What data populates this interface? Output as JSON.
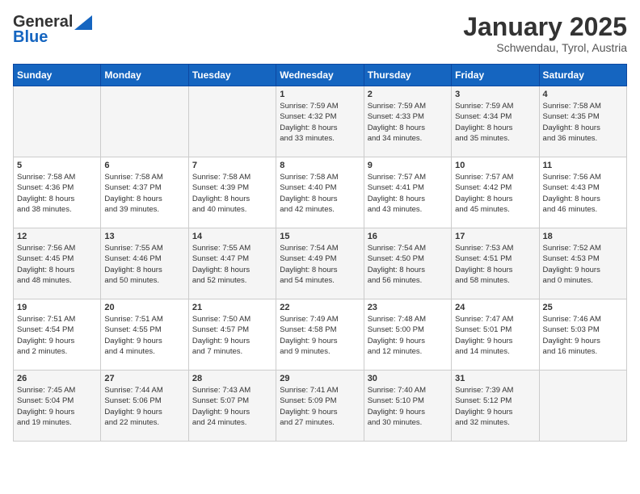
{
  "header": {
    "logo_line1": "General",
    "logo_line2": "Blue",
    "title": "January 2025",
    "subtitle": "Schwendau, Tyrol, Austria"
  },
  "calendar": {
    "days_of_week": [
      "Sunday",
      "Monday",
      "Tuesday",
      "Wednesday",
      "Thursday",
      "Friday",
      "Saturday"
    ],
    "weeks": [
      [
        {
          "day": "",
          "info": ""
        },
        {
          "day": "",
          "info": ""
        },
        {
          "day": "",
          "info": ""
        },
        {
          "day": "1",
          "info": "Sunrise: 7:59 AM\nSunset: 4:32 PM\nDaylight: 8 hours\nand 33 minutes."
        },
        {
          "day": "2",
          "info": "Sunrise: 7:59 AM\nSunset: 4:33 PM\nDaylight: 8 hours\nand 34 minutes."
        },
        {
          "day": "3",
          "info": "Sunrise: 7:59 AM\nSunset: 4:34 PM\nDaylight: 8 hours\nand 35 minutes."
        },
        {
          "day": "4",
          "info": "Sunrise: 7:58 AM\nSunset: 4:35 PM\nDaylight: 8 hours\nand 36 minutes."
        }
      ],
      [
        {
          "day": "5",
          "info": "Sunrise: 7:58 AM\nSunset: 4:36 PM\nDaylight: 8 hours\nand 38 minutes."
        },
        {
          "day": "6",
          "info": "Sunrise: 7:58 AM\nSunset: 4:37 PM\nDaylight: 8 hours\nand 39 minutes."
        },
        {
          "day": "7",
          "info": "Sunrise: 7:58 AM\nSunset: 4:39 PM\nDaylight: 8 hours\nand 40 minutes."
        },
        {
          "day": "8",
          "info": "Sunrise: 7:58 AM\nSunset: 4:40 PM\nDaylight: 8 hours\nand 42 minutes."
        },
        {
          "day": "9",
          "info": "Sunrise: 7:57 AM\nSunset: 4:41 PM\nDaylight: 8 hours\nand 43 minutes."
        },
        {
          "day": "10",
          "info": "Sunrise: 7:57 AM\nSunset: 4:42 PM\nDaylight: 8 hours\nand 45 minutes."
        },
        {
          "day": "11",
          "info": "Sunrise: 7:56 AM\nSunset: 4:43 PM\nDaylight: 8 hours\nand 46 minutes."
        }
      ],
      [
        {
          "day": "12",
          "info": "Sunrise: 7:56 AM\nSunset: 4:45 PM\nDaylight: 8 hours\nand 48 minutes."
        },
        {
          "day": "13",
          "info": "Sunrise: 7:55 AM\nSunset: 4:46 PM\nDaylight: 8 hours\nand 50 minutes."
        },
        {
          "day": "14",
          "info": "Sunrise: 7:55 AM\nSunset: 4:47 PM\nDaylight: 8 hours\nand 52 minutes."
        },
        {
          "day": "15",
          "info": "Sunrise: 7:54 AM\nSunset: 4:49 PM\nDaylight: 8 hours\nand 54 minutes."
        },
        {
          "day": "16",
          "info": "Sunrise: 7:54 AM\nSunset: 4:50 PM\nDaylight: 8 hours\nand 56 minutes."
        },
        {
          "day": "17",
          "info": "Sunrise: 7:53 AM\nSunset: 4:51 PM\nDaylight: 8 hours\nand 58 minutes."
        },
        {
          "day": "18",
          "info": "Sunrise: 7:52 AM\nSunset: 4:53 PM\nDaylight: 9 hours\nand 0 minutes."
        }
      ],
      [
        {
          "day": "19",
          "info": "Sunrise: 7:51 AM\nSunset: 4:54 PM\nDaylight: 9 hours\nand 2 minutes."
        },
        {
          "day": "20",
          "info": "Sunrise: 7:51 AM\nSunset: 4:55 PM\nDaylight: 9 hours\nand 4 minutes."
        },
        {
          "day": "21",
          "info": "Sunrise: 7:50 AM\nSunset: 4:57 PM\nDaylight: 9 hours\nand 7 minutes."
        },
        {
          "day": "22",
          "info": "Sunrise: 7:49 AM\nSunset: 4:58 PM\nDaylight: 9 hours\nand 9 minutes."
        },
        {
          "day": "23",
          "info": "Sunrise: 7:48 AM\nSunset: 5:00 PM\nDaylight: 9 hours\nand 12 minutes."
        },
        {
          "day": "24",
          "info": "Sunrise: 7:47 AM\nSunset: 5:01 PM\nDaylight: 9 hours\nand 14 minutes."
        },
        {
          "day": "25",
          "info": "Sunrise: 7:46 AM\nSunset: 5:03 PM\nDaylight: 9 hours\nand 16 minutes."
        }
      ],
      [
        {
          "day": "26",
          "info": "Sunrise: 7:45 AM\nSunset: 5:04 PM\nDaylight: 9 hours\nand 19 minutes."
        },
        {
          "day": "27",
          "info": "Sunrise: 7:44 AM\nSunset: 5:06 PM\nDaylight: 9 hours\nand 22 minutes."
        },
        {
          "day": "28",
          "info": "Sunrise: 7:43 AM\nSunset: 5:07 PM\nDaylight: 9 hours\nand 24 minutes."
        },
        {
          "day": "29",
          "info": "Sunrise: 7:41 AM\nSunset: 5:09 PM\nDaylight: 9 hours\nand 27 minutes."
        },
        {
          "day": "30",
          "info": "Sunrise: 7:40 AM\nSunset: 5:10 PM\nDaylight: 9 hours\nand 30 minutes."
        },
        {
          "day": "31",
          "info": "Sunrise: 7:39 AM\nSunset: 5:12 PM\nDaylight: 9 hours\nand 32 minutes."
        },
        {
          "day": "",
          "info": ""
        }
      ]
    ]
  }
}
